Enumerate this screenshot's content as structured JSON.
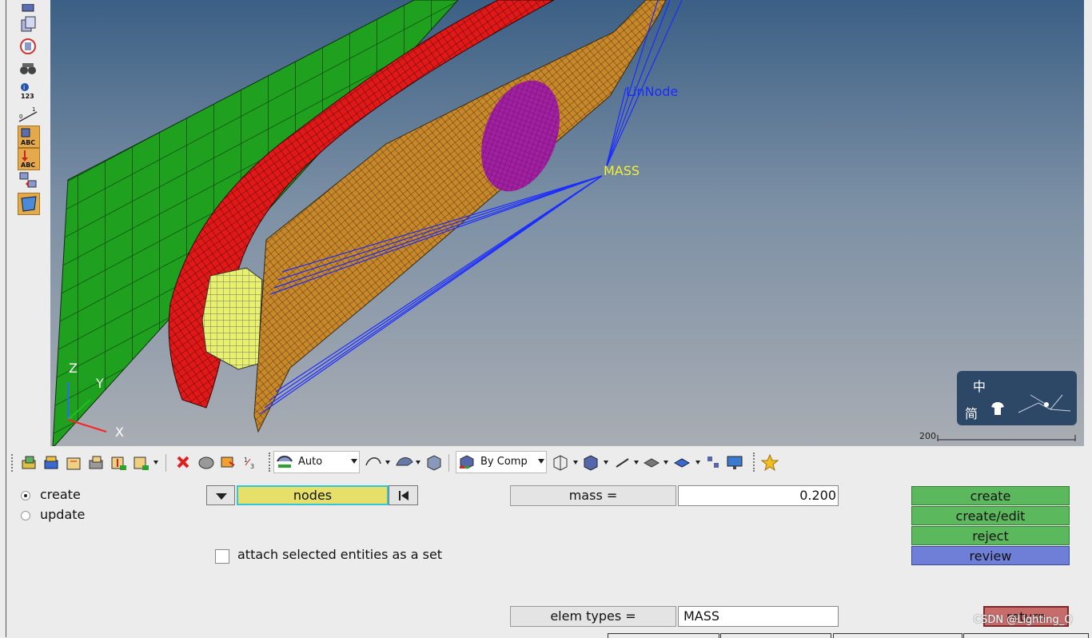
{
  "viewport": {
    "labels": {
      "linnode": "LinNode",
      "mass": "MASS"
    },
    "axes": {
      "z": "Z",
      "y": "Y",
      "x": "X"
    },
    "scale_value": "200",
    "ime": {
      "char1": "中",
      "char2": "简"
    }
  },
  "left_toolbar": {
    "icons": [
      "mesh-view-icon",
      "display-icon",
      "reverse-icon",
      "binoculars-icon",
      "info-123-icon",
      "scale-icon",
      "abc-label-icon",
      "abc-down-icon",
      "flip-icon",
      "surface-icon"
    ],
    "info_text": "123",
    "abc": "ABC"
  },
  "toolbar": {
    "auto_label": "Auto",
    "bycomp_label": "By Comp"
  },
  "panel": {
    "radio_create": "create",
    "radio_update": "update",
    "selector_entity": "nodes",
    "attach_label": "attach selected entities as a set",
    "mass_label": "mass =",
    "mass_value": "0.200",
    "elem_types_label": "elem types =",
    "elem_types_value": "MASS"
  },
  "commands": {
    "create": "create",
    "create_edit": "create/edit",
    "reject": "reject",
    "review": "review",
    "return": "return"
  },
  "watermark": "CSDN @Lighting_Q",
  "colors": {
    "green_button": "#5cb85c",
    "review_button": "#6f7fd8",
    "return_button": "#c86b6b",
    "nodes_field": "#e6e06a"
  }
}
